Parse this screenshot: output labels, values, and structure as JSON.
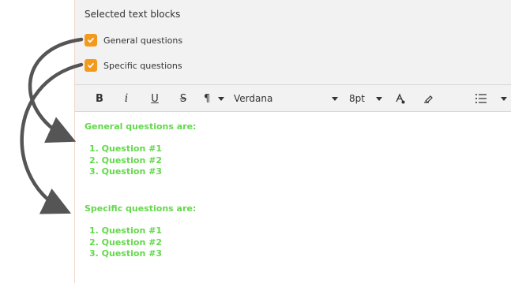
{
  "selected_blocks": {
    "title": "Selected text blocks",
    "items": [
      {
        "label": "General questions",
        "checked": true
      },
      {
        "label": "Specific questions",
        "checked": true
      }
    ]
  },
  "toolbar": {
    "bold_label": "B",
    "italic_label": "i",
    "underline_label": "U",
    "strikethrough_label": "S",
    "paragraph_label": "¶",
    "font_family": "Verdana",
    "font_size": "8pt",
    "icons": [
      "bold-icon",
      "italic-icon",
      "underline-icon",
      "strikethrough-icon",
      "paragraph-icon",
      "text-color-icon",
      "highlight-icon",
      "list-icon"
    ]
  },
  "editor": {
    "text_color": "#63d84b",
    "blocks": [
      {
        "heading": "General questions are:",
        "items": [
          "1. Question #1",
          "2. Question #2",
          "3. Question #3"
        ]
      },
      {
        "heading": "Specific questions are:",
        "items": [
          "1. Question #1",
          "2. Question #2",
          "3. Question #3"
        ]
      }
    ]
  },
  "colors": {
    "checkbox": "#f39a1d",
    "panel_background": "#f2f2f2",
    "arrow": "#555555"
  }
}
